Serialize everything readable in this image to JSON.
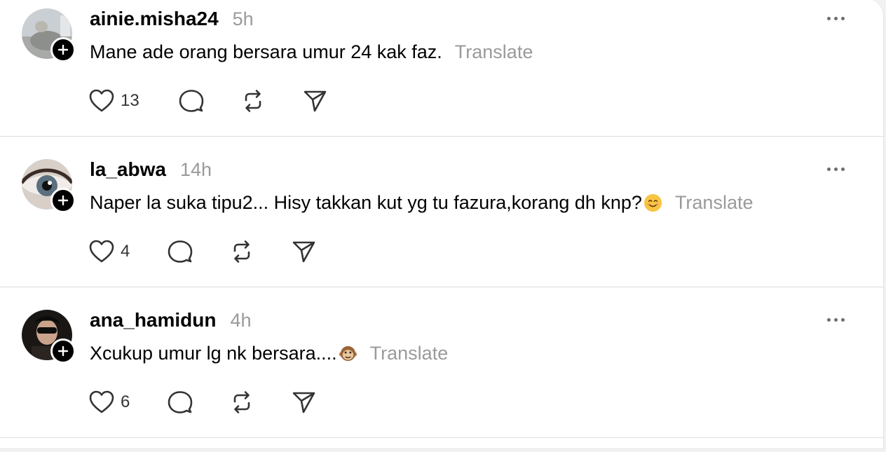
{
  "colors": {
    "text": "#000000",
    "muted": "#9a9a9a",
    "badge": "#000000",
    "divider": "#dcdcdc"
  },
  "icons": {
    "like": "heart-icon",
    "reply": "comment-bubble-icon",
    "repost": "repost-icon",
    "share": "send-icon",
    "more": "more-dots-icon",
    "follow": "plus-badge-icon"
  },
  "posts": [
    {
      "username": "ainie.misha24",
      "time": "5h",
      "text": "Mane ade orang bersara umur 24 kak faz.",
      "emoji": "",
      "translate": "Translate",
      "likes": "13"
    },
    {
      "username": "la_abwa",
      "time": "14h",
      "text": "Naper la suka tipu2... Hisy takkan kut yg tu fazura,korang dh knp?",
      "emoji": "smiling-face-emoji",
      "translate": "Translate",
      "likes": "4"
    },
    {
      "username": "ana_hamidun",
      "time": "4h",
      "text": "Xcukup umur lg nk bersara....",
      "emoji": "monkey-face-emoji",
      "translate": "Translate",
      "likes": "6"
    }
  ]
}
